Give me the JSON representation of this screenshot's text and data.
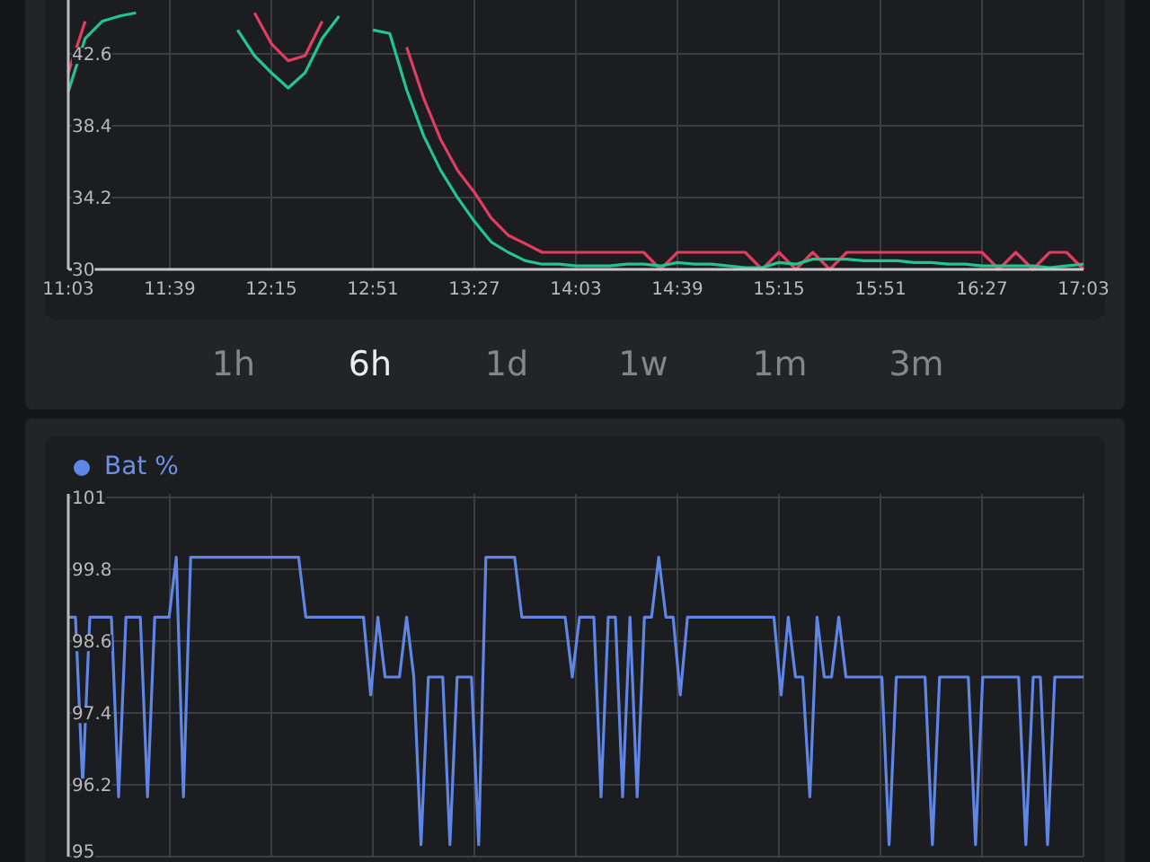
{
  "time_chart": {
    "chart_data": {
      "type": "line",
      "grid": true,
      "ylim": [
        30,
        45.75
      ],
      "yticks": [
        30,
        34.2,
        38.4,
        42.6
      ],
      "categories": [
        "11:03",
        null,
        null,
        null,
        null,
        null,
        "11:39",
        null,
        null,
        null,
        null,
        null,
        "12:15",
        null,
        null,
        null,
        null,
        null,
        "12:51",
        null,
        null,
        null,
        null,
        null,
        "13:27",
        null,
        null,
        null,
        null,
        null,
        "14:03",
        null,
        null,
        null,
        null,
        null,
        "14:39",
        null,
        null,
        null,
        null,
        null,
        "15:15",
        null,
        null,
        null,
        null,
        null,
        "15:51",
        null,
        null,
        null,
        null,
        null,
        "16:27",
        null,
        null,
        null,
        null,
        null,
        "17:03"
      ],
      "series": [
        {
          "color": "#e23d5e",
          "values": [
            41.5,
            44.5,
            null,
            null,
            null,
            null,
            null,
            null,
            null,
            null,
            null,
            45,
            43.2,
            42.2,
            42.5,
            44.5,
            null,
            null,
            null,
            null,
            43,
            40,
            37.6,
            35.8,
            34.5,
            33,
            32,
            31.5,
            31,
            31,
            31,
            31,
            31,
            31,
            31,
            30,
            31,
            31,
            31,
            31,
            31,
            30,
            31,
            30,
            31,
            30,
            31,
            31,
            31,
            31,
            31,
            31,
            31,
            31,
            31,
            30,
            31,
            30,
            31,
            31,
            30
          ]
        },
        {
          "color": "#22c58b",
          "values": [
            40.4,
            43.5,
            44.5,
            44.8,
            45,
            null,
            null,
            null,
            null,
            null,
            44,
            42.5,
            41.5,
            40.6,
            41.5,
            43.5,
            44.8,
            null,
            44,
            43.8,
            40.5,
            37.8,
            35.8,
            34.2,
            32.8,
            31.6,
            31,
            30.5,
            30.3,
            30.3,
            30.2,
            30.2,
            30.2,
            30.3,
            30.3,
            30.2,
            30.4,
            30.3,
            30.3,
            30.2,
            30.1,
            30.1,
            30.4,
            30.3,
            30.6,
            30.6,
            30.6,
            30.5,
            30.5,
            30.5,
            30.4,
            30.4,
            30.3,
            30.3,
            30.2,
            30.2,
            30.2,
            30.2,
            30.1,
            30.2,
            30.3
          ]
        }
      ]
    }
  },
  "range_tabs": [
    {
      "label": "1h",
      "selected": false
    },
    {
      "label": "6h",
      "selected": true
    },
    {
      "label": "1d",
      "selected": false
    },
    {
      "label": "1w",
      "selected": false
    },
    {
      "label": "1m",
      "selected": false
    },
    {
      "label": "3m",
      "selected": false
    }
  ],
  "battery_chart": {
    "legend": {
      "label": "Bat %",
      "color": "#5f86e4"
    },
    "chart_data": {
      "type": "line",
      "grid": true,
      "ylim": [
        95,
        101
      ],
      "yticks": [
        95,
        96.2,
        97.4,
        98.6,
        99.8,
        101
      ],
      "categories": [
        null,
        null,
        null,
        null,
        null,
        null,
        null,
        null,
        null,
        null,
        null,
        null,
        null,
        null,
        null,
        null,
        null,
        null,
        null,
        null,
        null,
        null,
        null,
        null,
        null,
        null,
        null,
        null,
        null,
        null,
        null,
        null,
        null,
        null,
        null,
        null,
        null,
        null,
        null,
        null,
        null,
        null,
        null,
        null,
        null,
        null,
        null,
        null,
        null,
        null,
        null,
        null,
        null,
        null,
        null,
        null,
        null,
        null,
        null,
        null,
        null,
        null,
        null,
        null,
        null,
        null,
        null,
        null,
        null,
        null,
        null,
        null,
        null,
        null,
        null,
        null,
        null,
        null,
        null,
        null,
        null,
        null,
        null,
        null,
        null,
        null,
        null,
        null,
        null,
        null,
        null,
        null,
        null,
        null,
        null,
        null,
        null,
        null,
        null,
        null,
        null,
        null,
        null,
        null,
        null,
        null,
        null,
        null,
        null,
        null,
        null,
        null,
        null,
        null,
        null,
        null,
        null,
        null,
        null,
        null,
        null,
        null,
        null,
        null,
        null,
        null,
        null,
        null,
        null,
        null,
        null,
        null,
        null,
        null,
        null,
        null,
        null,
        null,
        null,
        null,
        null,
        null
      ],
      "series": [
        {
          "color": "#5f86e4",
          "values": [
            99,
            99,
            96.2,
            99,
            99,
            99,
            99,
            96,
            99,
            99,
            99,
            96,
            99,
            99,
            99,
            100,
            96,
            100,
            100,
            100,
            100,
            100,
            100,
            100,
            100,
            100,
            100,
            100,
            100,
            100,
            100,
            100,
            100,
            99,
            99,
            99,
            99,
            99,
            99,
            99,
            99,
            99,
            97.7,
            99,
            98,
            98,
            98,
            99,
            98,
            95.2,
            98,
            98,
            98,
            95.2,
            98,
            98,
            98,
            95.2,
            100,
            100,
            100,
            100,
            100,
            99,
            99,
            99,
            99,
            99,
            99,
            99,
            98,
            99,
            99,
            99,
            96,
            99,
            99,
            96,
            99,
            96,
            99,
            99,
            100,
            99,
            99,
            97.7,
            99,
            99,
            99,
            99,
            99,
            99,
            99,
            99,
            99,
            99,
            99,
            99,
            99,
            97.7,
            99,
            98,
            98,
            96,
            99,
            98,
            98,
            99,
            98,
            98,
            98,
            98,
            98,
            98,
            95.2,
            98,
            98,
            98,
            98,
            98,
            95.2,
            98,
            98,
            98,
            98,
            98,
            95.2,
            98,
            98,
            98,
            98,
            98,
            98,
            95.2,
            98,
            98,
            95.2,
            98,
            98,
            98,
            98,
            98
          ]
        }
      ]
    }
  }
}
